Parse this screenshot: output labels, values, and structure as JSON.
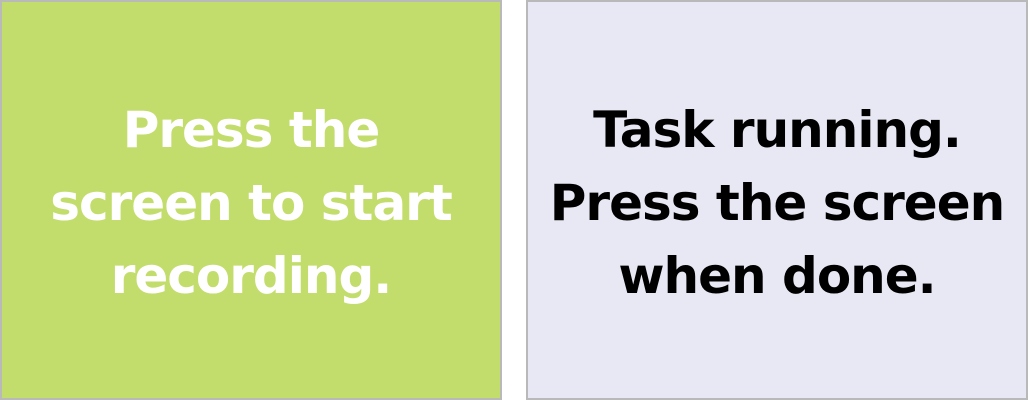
{
  "colors": {
    "start_panel_bg": "#c2dd6b",
    "start_panel_text": "#ffffff",
    "running_panel_bg": "#e8e8f4",
    "running_panel_text": "#000000",
    "panel_border": "#b9b9b9"
  },
  "start_panel": {
    "message": "Press the\nscreen to start\nrecording."
  },
  "running_panel": {
    "message": "Task running.\nPress the screen\nwhen done."
  }
}
